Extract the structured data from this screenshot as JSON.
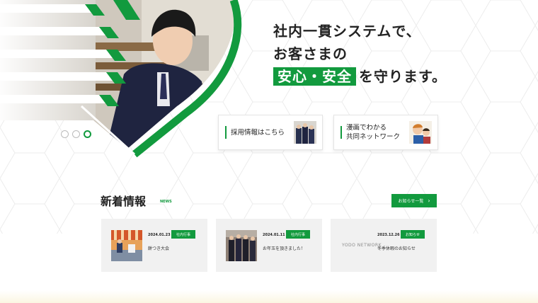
{
  "hero": {
    "headline_line1": "社内一貫システムで、",
    "headline_line2": "お客さまの",
    "headline_highlight": "安心・安全",
    "headline_line3_rest": "を守ります。",
    "slider": {
      "count": 3,
      "active": 3
    }
  },
  "cards": [
    {
      "label": "採用情報はこちら"
    },
    {
      "label_line1": "漫画でわかる",
      "label_line2": "共同ネットワーク"
    }
  ],
  "news": {
    "title": "新着情報",
    "sub": "NEWS",
    "all_button": "お知らせ一覧",
    "items": [
      {
        "date": "2024.01.23",
        "category": "社内行事",
        "title": "餅つき大会"
      },
      {
        "date": "2024.01.11",
        "category": "社内行事",
        "title": "お年玉を頂きました！"
      },
      {
        "date": "2023.12.26",
        "category": "お知らせ",
        "title": "冬季休暇のお知らせ",
        "logo": "YODO NETWORK"
      }
    ]
  },
  "colors": {
    "accent": "#129a3e",
    "card_bg": "#f1f1f1"
  }
}
